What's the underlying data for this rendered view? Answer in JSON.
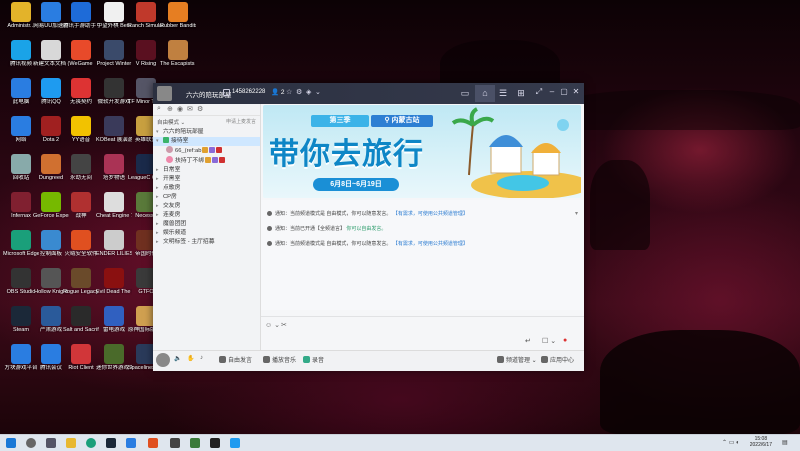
{
  "desktop_icons": [
    {
      "label": "Administr...",
      "color": "#e3b32a"
    },
    {
      "label": "网易UU加速器",
      "color": "#2a7de1"
    },
    {
      "label": "腾讯手游助手 完结官方...",
      "color": "#1e6bd8"
    },
    {
      "label": "中望外棋 Beta",
      "color": "#f0f0f0"
    },
    {
      "label": "Ranch Simulator",
      "color": "#c0392b"
    },
    {
      "label": "Rubber Bandits",
      "color": "#e67e22"
    },
    {
      "label": "腾讯视频",
      "color": "#1aa3e8"
    },
    {
      "label": "新建文本文档 (2)",
      "color": "#d8d8d8"
    },
    {
      "label": "WeGame",
      "color": "#e84a2a"
    },
    {
      "label": "Project Winter",
      "color": "#3a4a6a"
    },
    {
      "label": "V Rising",
      "color": "#5a1020"
    },
    {
      "label": "The Escapists 2",
      "color": "#c08040"
    },
    {
      "label": "此电脑",
      "color": "#2a7de1"
    },
    {
      "label": "腾讯QQ",
      "color": "#1e9bf0"
    },
    {
      "label": "无畏契约",
      "color": "#d33"
    },
    {
      "label": "微软开发游戏",
      "color": "#333"
    },
    {
      "label": "TF Minor Tail Dem",
      "color": "#556"
    },
    {
      "label": "网络",
      "color": "#2a7de1"
    },
    {
      "label": "Dota 2",
      "color": "#a02020"
    },
    {
      "label": "YY语音",
      "color": "#f2c200"
    },
    {
      "label": "KOBeat 展演游戏",
      "color": "#3a3a5a"
    },
    {
      "label": "英雄联盟",
      "color": "#c8a040"
    },
    {
      "label": "回收站",
      "color": "#8aa"
    },
    {
      "label": "Dungreed",
      "color": "#d07030"
    },
    {
      "label": "永劫无间",
      "color": "#444"
    },
    {
      "label": "塔罗物语",
      "color": "#aa3355"
    },
    {
      "label": "LeagueC Client",
      "color": "#1a2a4a"
    },
    {
      "label": "Infernax",
      "color": "#802030"
    },
    {
      "label": "GeForce Experience",
      "color": "#76b900"
    },
    {
      "label": "战神",
      "color": "#b03030"
    },
    {
      "label": "Cheat Engine 7.2",
      "color": "#ddd"
    },
    {
      "label": "Necesse",
      "color": "#5a7a3a"
    },
    {
      "label": "Microsoft Edge",
      "color": "#1a9f7a"
    },
    {
      "label": "控制面板",
      "color": "#3a8ad0"
    },
    {
      "label": "火绒安全软件",
      "color": "#e05020"
    },
    {
      "label": "ENDER LILIES",
      "color": "#ccc"
    },
    {
      "label": "帝国时代",
      "color": "#703020"
    },
    {
      "label": "OBS Studio",
      "color": "#333"
    },
    {
      "label": "Hollow Knight",
      "color": "#555"
    },
    {
      "label": "Rogue Legacy 2",
      "color": "#6a4a2a"
    },
    {
      "label": "Evil Dead The Game",
      "color": "#8a1010"
    },
    {
      "label": "GTFO",
      "color": "#3a3a3a"
    },
    {
      "label": "Steam",
      "color": "#1b2838"
    },
    {
      "label": "严肃游戏",
      "color": "#2a5a9a"
    },
    {
      "label": "Salt and Sacrifice",
      "color": "#2a2a2a"
    },
    {
      "label": "雷电游戏",
      "color": "#3060c0"
    },
    {
      "label": "原神国际版 Badge",
      "color": "#d0a050"
    },
    {
      "label": "方块游戏平台",
      "color": "#2a7de1"
    },
    {
      "label": "腾讯会议",
      "color": "#2a7de1"
    },
    {
      "label": "Riot Client",
      "color": "#d13639"
    },
    {
      "label": "迷你世界游戏 Peglin",
      "color": "#4a6a2a"
    },
    {
      "label": "Spacelines From Th...",
      "color": "#2a3a5a"
    }
  ],
  "window": {
    "group_name": "六六的陪玩部屋",
    "group_id": "1458262228",
    "member_count": "2",
    "toolbar_icons": [
      "tv-icon",
      "home-icon",
      "list-icon",
      "gamepad-icon",
      "share-icon",
      "minus-icon",
      "restore-icon",
      "close-icon"
    ],
    "sidebar": {
      "mode_label": "自由模式 ⌄",
      "apply_label": "申请上麦发言",
      "items": [
        {
          "label": "六六的陪玩部屋",
          "type": "root"
        },
        {
          "label": "接待室",
          "type": "channel",
          "selected": true
        },
        {
          "label": "66_(ref:ab",
          "type": "member",
          "color": "#c9a"
        },
        {
          "label": "扶持丁不绑",
          "type": "member",
          "color": "#e8a"
        },
        {
          "label": "日常室",
          "type": "channel"
        },
        {
          "label": "开黑室",
          "type": "channel"
        },
        {
          "label": "点歌房",
          "type": "channel"
        },
        {
          "label": "CP房",
          "type": "channel"
        },
        {
          "label": "交友房",
          "type": "channel"
        },
        {
          "label": "连麦房",
          "type": "channel"
        },
        {
          "label": "魔兽团团",
          "type": "channel"
        },
        {
          "label": "娱乐频道",
          "type": "channel"
        },
        {
          "label": "文明标签 - 主厅招募",
          "type": "channel"
        }
      ]
    },
    "banner": {
      "season": "第三季",
      "location": "内蒙古站",
      "headline": "带你去旅行",
      "dates": "6月8日~6月19日"
    },
    "messages": [
      {
        "prefix": "通知：",
        "text": "当前频道模式是 自由模式，你可以随意发言。",
        "link": "【有需求，可使用公共频道管理】"
      },
      {
        "prefix": "通知：",
        "text": "当前已开通【全频道言】",
        "link": "你可以自由发言。"
      },
      {
        "prefix": "通知：",
        "text": "当前频道模式是 自由模式，你可以随意发言。",
        "link": "【有需求，可使用公共频道管理】"
      }
    ],
    "bottom_bar": {
      "free_mode": "自由发言",
      "play_music": "播放音乐",
      "listen": "录音",
      "mic_manage": "频道管理",
      "app_center": "应用中心"
    }
  },
  "taskbar": {
    "time": "15:08",
    "date": "2022/6/17"
  }
}
